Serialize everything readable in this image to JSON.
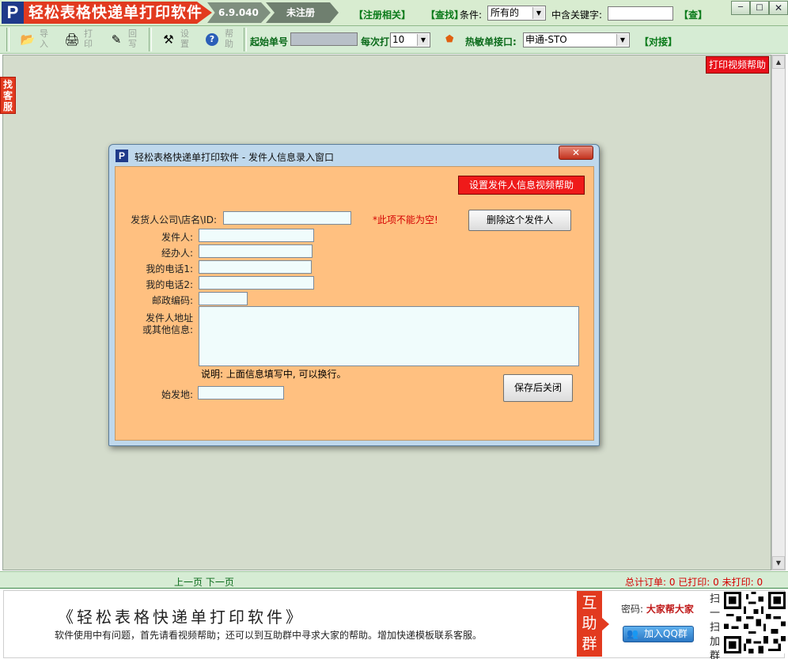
{
  "titlebar": {
    "logo_letter": "P",
    "app_title": "轻松表格快递单打印软件",
    "version": "6.9.040",
    "register_status": "未注册",
    "register_link": "【注册相关】",
    "search_link": "【查找】",
    "condition_label": "条件:",
    "condition_value": "所有的",
    "keyword_label": "中含关键字:",
    "keyword_value": "",
    "query_link": "【查】",
    "minimize": "─",
    "restore": "□",
    "close": "✕"
  },
  "toolbar": {
    "buttons": [
      {
        "icon": "📂",
        "label": "导入"
      },
      {
        "icon": "🖨",
        "label": "打印"
      },
      {
        "icon": "✎",
        "label": "回写"
      },
      {
        "icon": "⚒",
        "label": "设置"
      },
      {
        "icon": "?",
        "label": "帮助"
      }
    ],
    "start_no_label": "起始单号",
    "start_no_value": "",
    "per_print_label": "每次打",
    "per_print_value": "10",
    "hot_label": "热敏单接口:",
    "hot_value": "申通-STO",
    "dock_link": "【对接】"
  },
  "side": {
    "find_service": "找客服",
    "print_video_help": "打印视频帮助"
  },
  "dialog": {
    "icon_letter": "P",
    "title": "轻松表格快递单打印软件 - 发件人信息录入窗口",
    "close": "✕",
    "setting_help_button": "设置发件人信息视频帮助",
    "delete_button": "删除这个发件人",
    "required_note": "*此项不能为空!",
    "fields": {
      "company_label": "发货人公司\\店名\\ID:",
      "sender_label": "发件人:",
      "handler_label": "经办人:",
      "phone1_label": "我的电话1:",
      "phone2_label": "我的电话2:",
      "postcode_label": "邮政编码:",
      "address_label_1": "发件人地址",
      "address_label_2": "或其他信息:",
      "origin_label": "始发地:"
    },
    "note": "说明: 上面信息填写中, 可以换行。",
    "save_close_button": "保存后关闭"
  },
  "status": {
    "prev_page": "上一页",
    "next_page": "下一页",
    "counts": "总计订单: 0 已打印: 0 未打印: 0"
  },
  "banner": {
    "title": "《轻松表格快递单打印软件》",
    "subtitle": "软件使用中有问题，首先请看视频帮助；还可以到互助群中寻求大家的帮助。增加快递模板联系客服。",
    "help_group": "互助群",
    "password_label": "密码:",
    "password_value": "大家帮大家",
    "qq_button": "加入QQ群",
    "scan_text": "扫一扫加群"
  },
  "colors": {
    "brand_red": "#e23a1f",
    "green_text": "#0a7a1a",
    "dialog_body": "#ffc080",
    "main_bg": "#d4dccc"
  }
}
